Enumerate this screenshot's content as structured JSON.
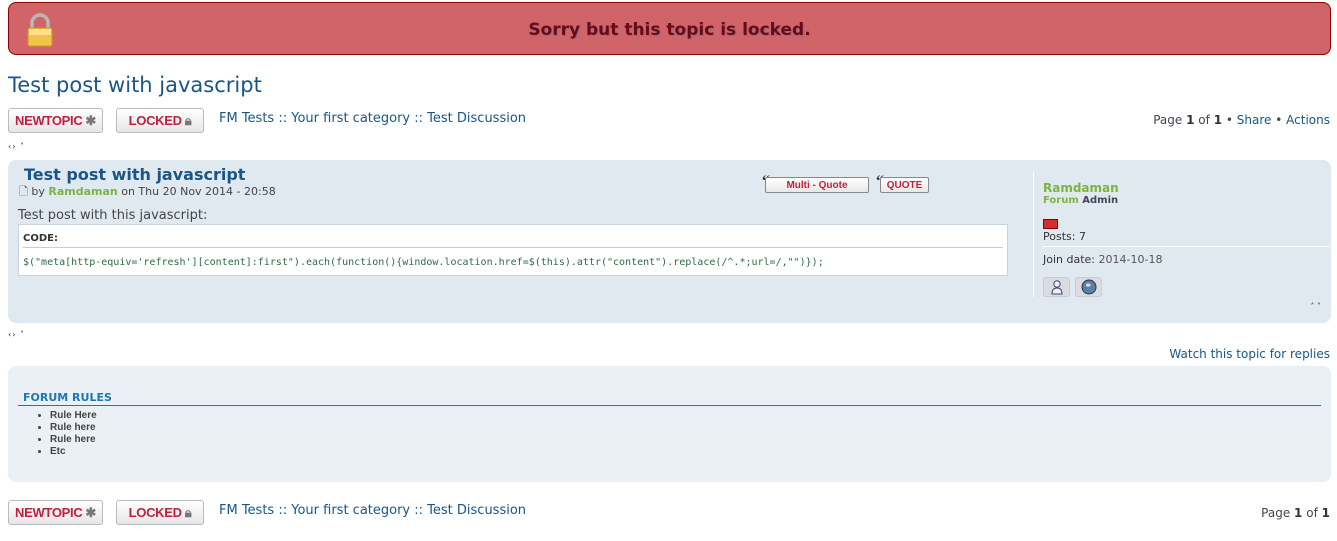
{
  "banner": {
    "message": "Sorry but this topic is locked.",
    "icon": "lock-icon"
  },
  "topic": {
    "title": "Test post with javascript"
  },
  "toolbar_top": {
    "new_topic_label": "NEWTOPIC",
    "locked_label": "LOCKED",
    "breadcrumb": [
      "FM Tests",
      "Your first category",
      "Test Discussion"
    ],
    "breadcrumb_sep": "::",
    "pager": {
      "prefix": "Page",
      "current": "1",
      "of": "of",
      "total": "1",
      "share": "Share",
      "actions": "Actions",
      "bullet": "•"
    }
  },
  "nav_top": "‹› ˅",
  "post": {
    "title": "Test post with javascript",
    "by": "by",
    "author": "Ramdaman",
    "date": "on Thu 20 Nov 2014 - 20:58",
    "body": "Test post with this javascript:",
    "code_label": "CODE:",
    "code": "$(\"meta[http-equiv='refresh'][content]:first\").each(function(){window.location.href=$(this).attr(\"content\").replace(/^.*;url=/,\"\")});",
    "multi_quote_label": "Multi - Quote",
    "quote_label": "QUOTE",
    "profile": {
      "username": "Ramdaman",
      "rank_part1": "Forum",
      "rank_part2": "Admin",
      "posts_label": "Posts:",
      "posts": "7",
      "join_label": "Join date:",
      "join_date": "2014-10-18"
    },
    "updown": "˄ ˅"
  },
  "nav_bottom": "‹› ˄",
  "watch_link": "Watch this topic for replies",
  "rules": {
    "title": "FORUM RULES",
    "items": [
      "Rule Here",
      "Rule here",
      "Rule here",
      "Etc"
    ]
  },
  "toolbar_bottom": {
    "new_topic_label": "NEWTOPIC",
    "locked_label": "LOCKED",
    "breadcrumb": [
      "FM Tests",
      "Your first category",
      "Test Discussion"
    ],
    "breadcrumb_sep": "::",
    "pager": {
      "prefix": "Page",
      "current": "1",
      "of": "of",
      "total": "1"
    }
  }
}
